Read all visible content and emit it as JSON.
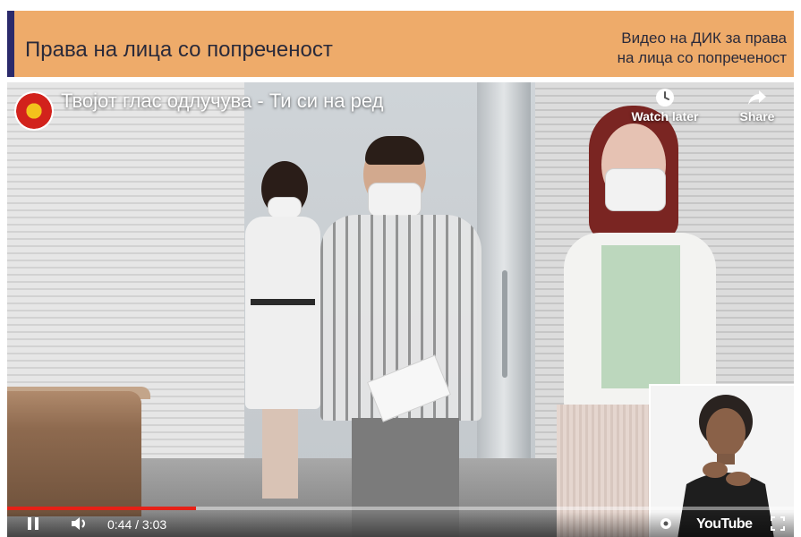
{
  "banner": {
    "title": "Права на лица со попреченост",
    "subtitle_line1": "Видео на ДИК за права",
    "subtitle_line2": "на лица со попреченост"
  },
  "video": {
    "title": "Твојот глас одлучува - Ти си на ред",
    "watch_later_label": "Watch later",
    "share_label": "Share",
    "time": "0:44 / 3:03",
    "progress": 0.24,
    "brand": "YouTube"
  },
  "colors": {
    "banner_bg": "#eeab6a",
    "banner_accent": "#2b2a6b",
    "progress": "#e62117"
  }
}
